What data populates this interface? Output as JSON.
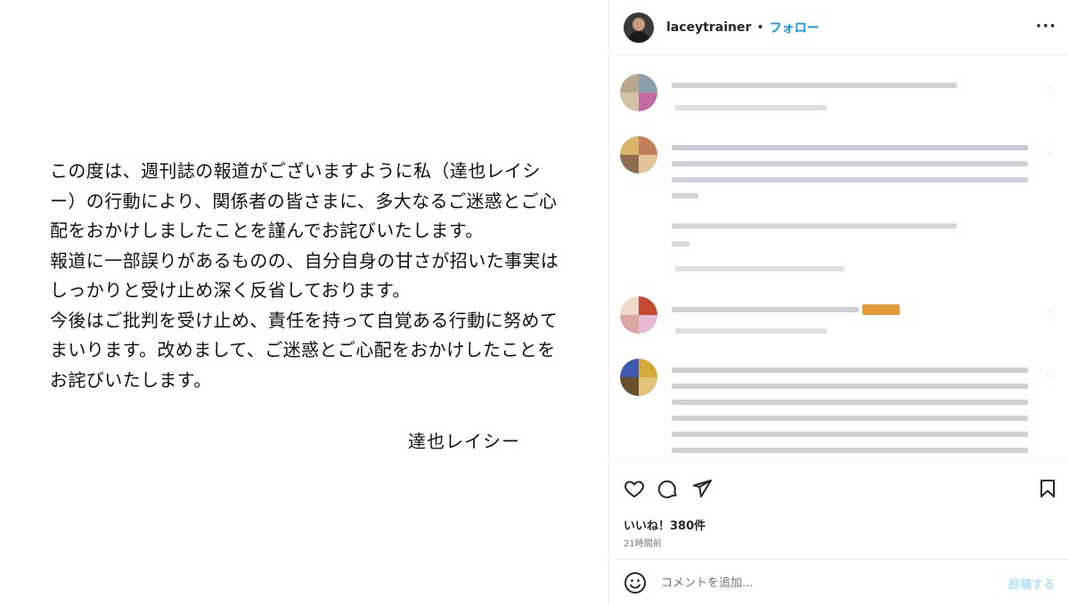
{
  "post": {
    "statement_lines": [
      "この度は、週刊誌の報道がございますように私（達也レイシ",
      "ー）の行動により、関係者の皆さまに、多大なるご迷惑とご心",
      "配をおかけしましたことを謹んでお詫びいたします。",
      "報道に一部誤りがあるものの、自分自身の甘さが招いた事実は",
      "しっかりと受け止め深く反省しております。",
      "今後はご批判を受け止め、責任を持って自覚ある行動に努めて",
      "まいります。改めまして、ご迷惑とご心配をおかけしたことを",
      "お詫びいたします。"
    ],
    "signature": "達也レイシー"
  },
  "header": {
    "username": "laceytrainer",
    "separator": "•",
    "follow_label": "フォロー",
    "more_label": "···"
  },
  "comments": {
    "avatar_colors": [
      [
        "#b8a690",
        "#8a9fa8",
        "#d4c2a6",
        "#c46aa3"
      ],
      [
        "#d9b46b",
        "#c27e5a",
        "#8c6e4f",
        "#e2c59b"
      ],
      [
        "#f0d8cc",
        "#c44a33",
        "#d8a8a0",
        "#e7b9d5"
      ],
      [
        "#3d5ab0",
        "#d6a93c",
        "#6a4f2b",
        "#e3c27a"
      ]
    ]
  },
  "actions": {
    "likes": "いいね！380件",
    "time": "21時間前"
  },
  "comment_box": {
    "placeholder": "コメントを追加...",
    "post_label": "投稿する"
  },
  "colors": {
    "accent": "#0095f6",
    "post_disabled": "#b2dffc",
    "text": "#262626",
    "muted": "#737373"
  }
}
